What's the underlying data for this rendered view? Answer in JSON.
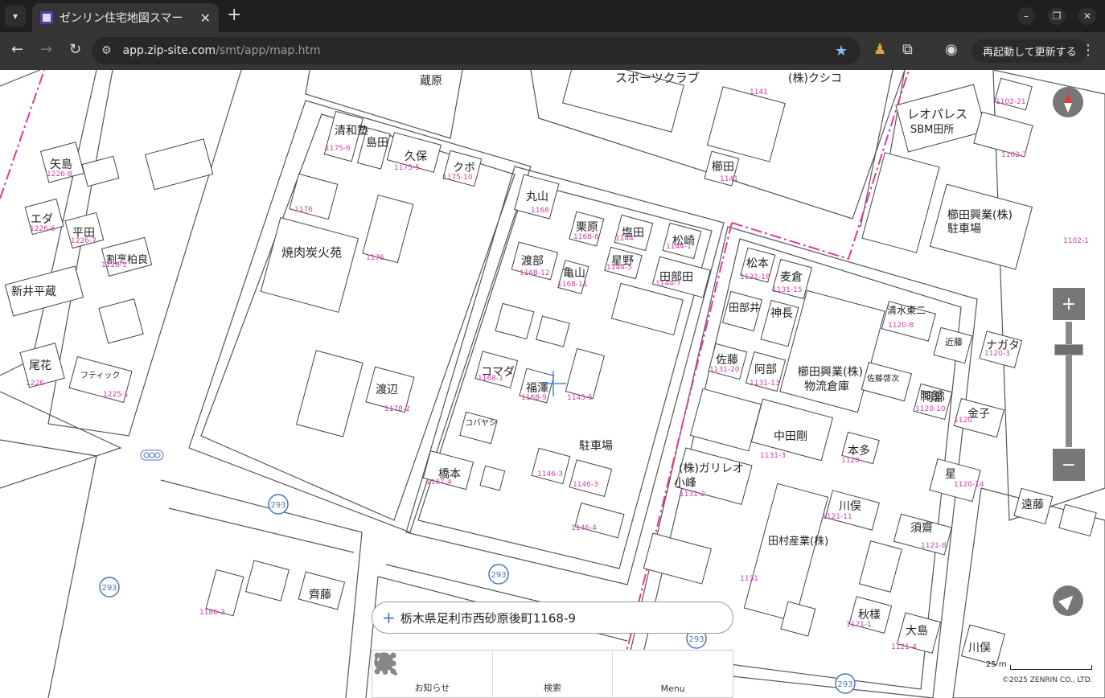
{
  "browser": {
    "tab_title": "ゼンリン住宅地図スマー",
    "url_host": "app.zip-site.com",
    "url_path": "/smt/app/map.htm",
    "restart_label": "再起動して更新する"
  },
  "map": {
    "address": "栃木県足利市西砂原後町1168-9",
    "scale_label": "25 m",
    "copyright": "©2025 ZENRIN CO., LTD.",
    "labels": [
      {
        "id": "l1",
        "text": "矢島"
      },
      {
        "id": "l2",
        "text": "エダ"
      },
      {
        "id": "l3",
        "text": "平田"
      },
      {
        "id": "l4",
        "text": "割烹柏良"
      },
      {
        "id": "l5",
        "text": "新井平蔵"
      },
      {
        "id": "l6",
        "text": "尾花"
      },
      {
        "id": "l7",
        "text": "清和塾"
      },
      {
        "id": "l8",
        "text": "島田"
      },
      {
        "id": "l9",
        "text": "久保"
      },
      {
        "id": "l10",
        "text": "クボ"
      },
      {
        "id": "l11",
        "text": "蔵原"
      },
      {
        "id": "l12",
        "text": "焼肉炭火苑"
      },
      {
        "id": "l13",
        "text": "渡辺"
      },
      {
        "id": "l14",
        "text": "丸山"
      },
      {
        "id": "l15",
        "text": "栗原"
      },
      {
        "id": "l16",
        "text": "塩田"
      },
      {
        "id": "l17",
        "text": "松崎"
      },
      {
        "id": "l18",
        "text": "渡部"
      },
      {
        "id": "l19",
        "text": "亀山"
      },
      {
        "id": "l20",
        "text": "星野"
      },
      {
        "id": "l21",
        "text": "田部田"
      },
      {
        "id": "l22",
        "text": "コマダ"
      },
      {
        "id": "l23",
        "text": "福澤"
      },
      {
        "id": "l24",
        "text": "駐車場"
      },
      {
        "id": "l25",
        "text": "橋本"
      },
      {
        "id": "l26",
        "text": "(株)ガリレオ"
      },
      {
        "id": "l27",
        "text": "小峰"
      },
      {
        "id": "l28",
        "text": "田村産業(株)"
      },
      {
        "id": "l29",
        "text": "松本"
      },
      {
        "id": "l30",
        "text": "麦倉"
      },
      {
        "id": "l31",
        "text": "田部井"
      },
      {
        "id": "l32",
        "text": "神長"
      },
      {
        "id": "l33",
        "text": "佐藤"
      },
      {
        "id": "l34",
        "text": "阿部"
      },
      {
        "id": "l35",
        "text": "中田剛"
      },
      {
        "id": "l36",
        "text": "本多"
      },
      {
        "id": "l37",
        "text": "川俣"
      },
      {
        "id": "l38",
        "text": "須齋"
      },
      {
        "id": "l39",
        "text": "秋樣"
      },
      {
        "id": "l40",
        "text": "大島"
      },
      {
        "id": "l41",
        "text": "櫛田興業(株)"
      },
      {
        "id": "l42",
        "text": "物流倉庫"
      },
      {
        "id": "l43",
        "text": "清水東二"
      },
      {
        "id": "l44",
        "text": "ナガタ"
      },
      {
        "id": "l45",
        "text": "阿部"
      },
      {
        "id": "l46",
        "text": "金子"
      },
      {
        "id": "l47",
        "text": "星"
      },
      {
        "id": "l48",
        "text": "遠藤"
      },
      {
        "id": "l49",
        "text": "レオパレス"
      },
      {
        "id": "l50",
        "text": "SBM田所"
      },
      {
        "id": "l51",
        "text": "櫛田興業(株)"
      },
      {
        "id": "l52",
        "text": "駐車場"
      },
      {
        "id": "l53",
        "text": "(株)クシコ"
      },
      {
        "id": "l54",
        "text": "櫛田"
      },
      {
        "id": "l55",
        "text": "齊藤"
      },
      {
        "id": "l56",
        "text": "川俣"
      },
      {
        "id": "l57",
        "text": "スポーツクラブ"
      },
      {
        "id": "l58",
        "text": "コバヤシ"
      },
      {
        "id": "l59",
        "text": "佐藤啓次"
      },
      {
        "id": "l60",
        "text": "近藤"
      },
      {
        "id": "l61",
        "text": "フティック"
      },
      {
        "id": "l62",
        "text": "阿部"
      }
    ],
    "route_numbers": [
      {
        "id": "r1",
        "text": "293"
      },
      {
        "id": "r2",
        "text": "293"
      },
      {
        "id": "r3",
        "text": "293"
      },
      {
        "id": "r4",
        "text": "293"
      },
      {
        "id": "r5",
        "text": "293"
      }
    ],
    "lot_numbers": [
      {
        "id": "n1",
        "text": "1226-8"
      },
      {
        "id": "n2",
        "text": "1226-6"
      },
      {
        "id": "n3",
        "text": "1226-7"
      },
      {
        "id": "n4",
        "text": "1226-1"
      },
      {
        "id": "n5",
        "text": "1226"
      },
      {
        "id": "n6",
        "text": "1175-6"
      },
      {
        "id": "n7",
        "text": "1175-5"
      },
      {
        "id": "n8",
        "text": "1175-10"
      },
      {
        "id": "n9",
        "text": "1176"
      },
      {
        "id": "n10",
        "text": "1176"
      },
      {
        "id": "n11",
        "text": "1168"
      },
      {
        "id": "n12",
        "text": "1168-6"
      },
      {
        "id": "n13",
        "text": "1144"
      },
      {
        "id": "n14",
        "text": "1144-1"
      },
      {
        "id": "n15",
        "text": "1168-12"
      },
      {
        "id": "n16",
        "text": "1168-11"
      },
      {
        "id": "n17",
        "text": "1144-5"
      },
      {
        "id": "n18",
        "text": "1144-7"
      },
      {
        "id": "n19",
        "text": "1168-1"
      },
      {
        "id": "n20",
        "text": "1168-9"
      },
      {
        "id": "n21",
        "text": "1145-5"
      },
      {
        "id": "n22",
        "text": "1167-4"
      },
      {
        "id": "n23",
        "text": "1146-3"
      },
      {
        "id": "n24",
        "text": "1146-3"
      },
      {
        "id": "n25",
        "text": "1146-4"
      },
      {
        "id": "n26",
        "text": "1131-2"
      },
      {
        "id": "n27",
        "text": "1131"
      },
      {
        "id": "n28",
        "text": "1131-18"
      },
      {
        "id": "n29",
        "text": "1131-15"
      },
      {
        "id": "n30",
        "text": "1131-20"
      },
      {
        "id": "n31",
        "text": "1131-13"
      },
      {
        "id": "n32",
        "text": "1131-3"
      },
      {
        "id": "n33",
        "text": "1120"
      },
      {
        "id": "n34",
        "text": "1121-11"
      },
      {
        "id": "n35",
        "text": "1121-8"
      },
      {
        "id": "n36",
        "text": "1121-1"
      },
      {
        "id": "n37",
        "text": "1121-4"
      },
      {
        "id": "n38",
        "text": "1120-8"
      },
      {
        "id": "n39",
        "text": "1120-3"
      },
      {
        "id": "n40",
        "text": "1120-10"
      },
      {
        "id": "n41",
        "text": "1120"
      },
      {
        "id": "n42",
        "text": "1120-14"
      },
      {
        "id": "n43",
        "text": "1102-21"
      },
      {
        "id": "n44",
        "text": "1102-7"
      },
      {
        "id": "n45",
        "text": "1102-1"
      },
      {
        "id": "n46",
        "text": "1141"
      },
      {
        "id": "n47",
        "text": "1141"
      },
      {
        "id": "n48",
        "text": "1186-3"
      },
      {
        "id": "n49",
        "text": "1225-1"
      },
      {
        "id": "n50",
        "text": "1178-2"
      }
    ]
  },
  "bottom_menu": {
    "notice_label": "お知らせ",
    "search_label": "検索",
    "menu_label": "Menu"
  },
  "colors": {
    "chrome_dark": "#1f1f1f",
    "chrome_toolbar": "#353535",
    "map_boundary": "#e0399c",
    "map_control": "#777777",
    "lot_number": "#d63bb0"
  }
}
